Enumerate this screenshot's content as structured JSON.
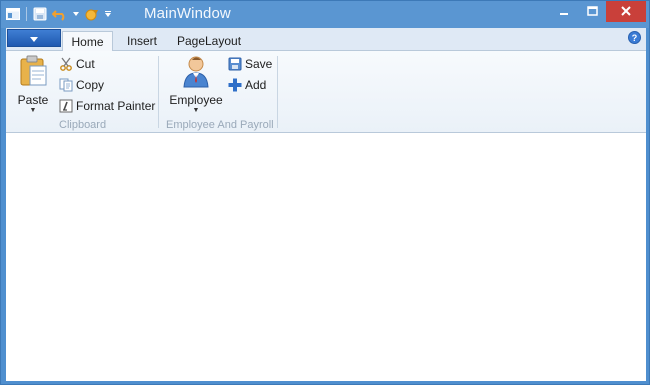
{
  "window": {
    "title": "MainWindow"
  },
  "quick_access": {
    "icons": [
      "app-icon",
      "save-icon",
      "undo-icon",
      "redo-icon",
      "customize-dropdown-icon"
    ]
  },
  "ribbon": {
    "tabs": [
      {
        "label": "Home",
        "active": true
      },
      {
        "label": "Insert",
        "active": false
      },
      {
        "label": "PageLayout",
        "active": false
      }
    ],
    "groups": {
      "clipboard": {
        "label": "Clipboard",
        "paste_label": "Paste",
        "cut_label": "Cut",
        "copy_label": "Copy",
        "format_painter_label": "Format Painter"
      },
      "employee": {
        "label": "Employee And Payroll",
        "employee_label": "Employee",
        "save_label": "Save",
        "add_label": "Add"
      }
    }
  },
  "colors": {
    "titlebar": "#5a96d2",
    "close_button": "#c9403a",
    "tab_strip": "#dfe9f5",
    "ribbon_body": "#eef3f9",
    "group_label": "#9aa9b9"
  }
}
